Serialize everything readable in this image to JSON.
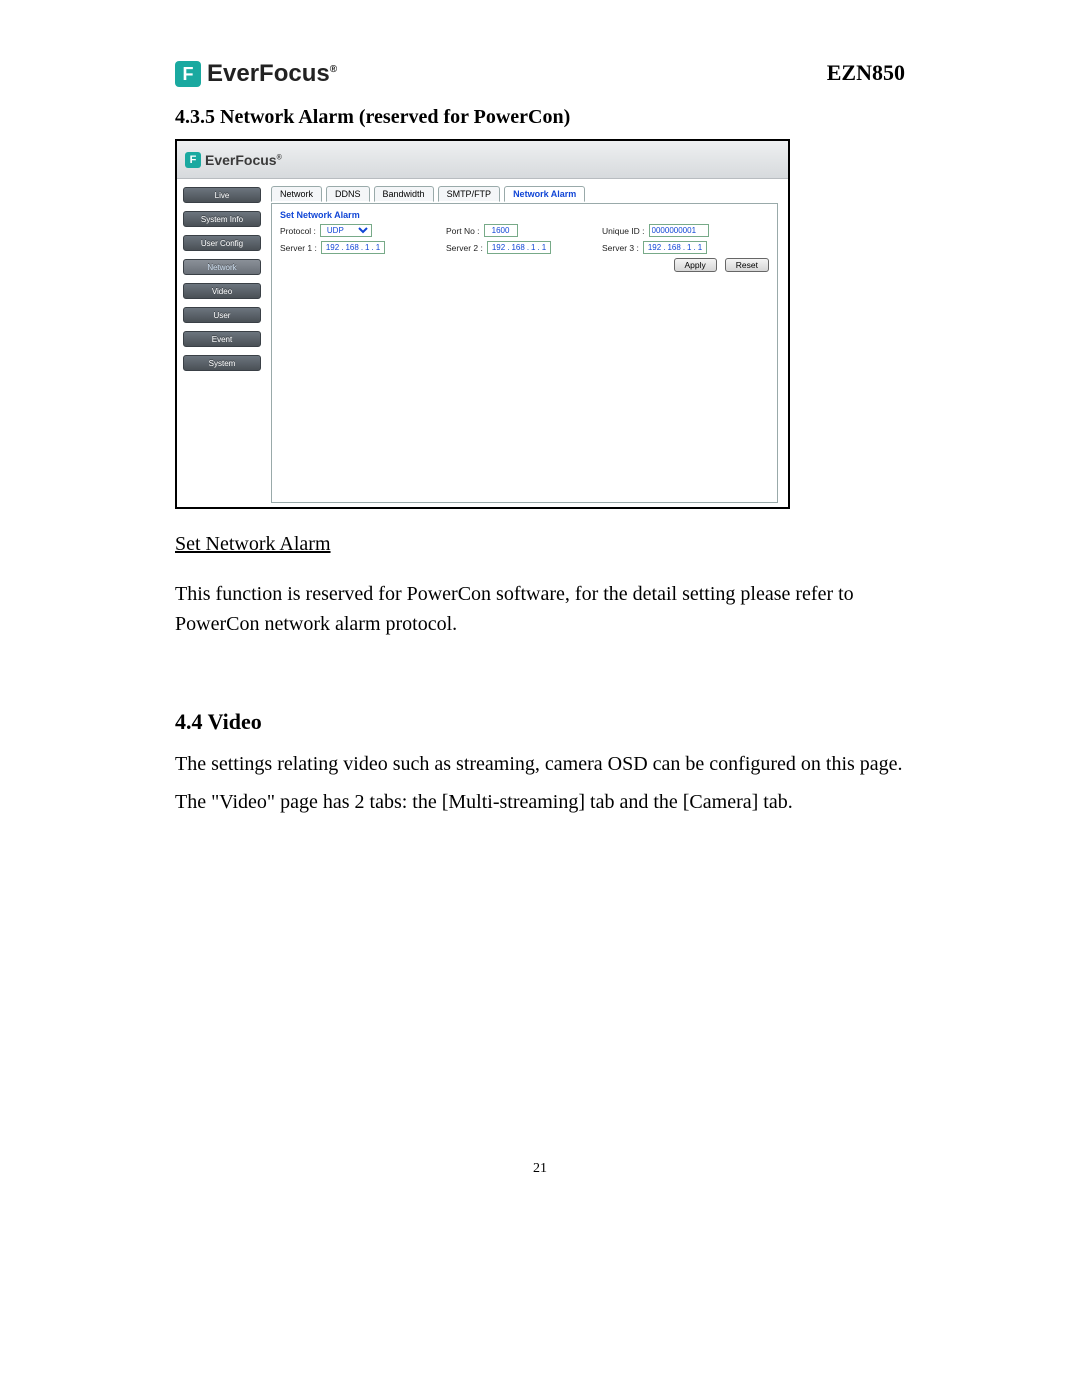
{
  "header": {
    "brand": "EverFocus",
    "brand_mark": "F",
    "registered": "®",
    "model": "EZN850"
  },
  "section_435": {
    "heading": "4.3.5 Network Alarm (reserved for PowerCon)"
  },
  "screenshot": {
    "brand": "EverFocus",
    "brand_mark": "F",
    "registered": "®",
    "sidebar": {
      "items": [
        {
          "label": "Live"
        },
        {
          "label": "System Info"
        },
        {
          "label": "User Config"
        },
        {
          "label": "Network"
        },
        {
          "label": "Video"
        },
        {
          "label": "User"
        },
        {
          "label": "Event"
        },
        {
          "label": "System"
        }
      ]
    },
    "tabs": {
      "items": [
        {
          "label": "Network"
        },
        {
          "label": "DDNS"
        },
        {
          "label": "Bandwidth"
        },
        {
          "label": "SMTP/FTP"
        },
        {
          "label": "Network Alarm"
        }
      ]
    },
    "panel": {
      "title": "Set Network Alarm",
      "protocol_label": "Protocol :",
      "protocol_value": "UDP",
      "port_label": "Port No :",
      "port_value": "1600",
      "uniqueid_label": "Unique ID :",
      "uniqueid_value": "0000000001",
      "server1_label": "Server 1 :",
      "server2_label": "Server 2 :",
      "server3_label": "Server 3 :",
      "ip": {
        "a": "192",
        "b": "168",
        "c": "1",
        "d": "1"
      },
      "apply": "Apply",
      "reset": "Reset"
    }
  },
  "body": {
    "subhead": "Set Network Alarm",
    "para1": "This function is reserved for PowerCon software, for the detail setting please refer to PowerCon network alarm protocol."
  },
  "section_44": {
    "heading": "4.4 Video",
    "para1": "The settings relating video such as streaming, camera OSD can be configured on this page.",
    "para2": "The \"Video\" page has 2 tabs: the [Multi-streaming] tab and the [Camera] tab."
  },
  "page_number": "21"
}
